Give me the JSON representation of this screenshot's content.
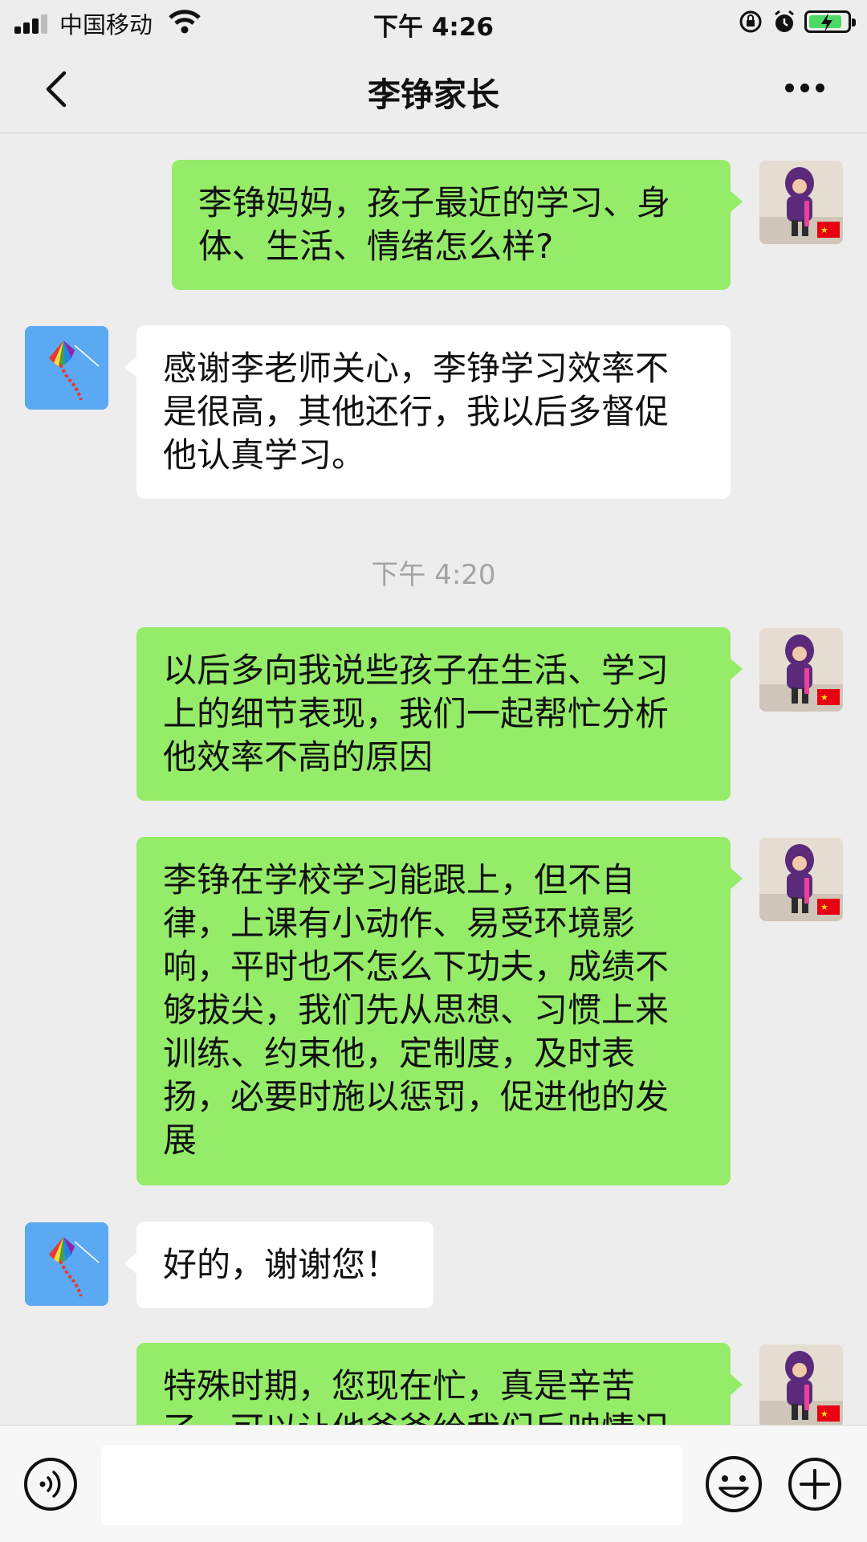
{
  "status_bar": {
    "carrier": "中国移动",
    "time": "下午 4:26"
  },
  "header": {
    "title": "李铮家长"
  },
  "messages": [
    {
      "sender": "me",
      "text": "李铮妈妈，孩子最近的学习、身\n体、生活、情绪怎么样?"
    },
    {
      "sender": "contact",
      "text": "感谢李老师关心，李铮学习效率不\n是很高，其他还行，我以后多督促\n他认真学习。"
    },
    {
      "sender": "me",
      "text": "以后多向我说些孩子在生活、学习\n上的细节表现，我们一起帮忙分析\n他效率不高的原因"
    },
    {
      "sender": "me",
      "text": "李铮在学校学习能跟上，但不自\n律，上课有小动作、易受环境影\n响，平时也不怎么下功夫，成绩不\n够拔尖，我们先从思想、习惯上来\n训练、约束他，定制度，及时表\n扬，必要时施以惩罚，促进他的发\n展"
    },
    {
      "sender": "contact",
      "text": "好的，谢谢您！"
    },
    {
      "sender": "me",
      "text": "特殊时期，您现在忙，真是辛苦\n了，可以让他爸爸给我们反映情况"
    }
  ],
  "timestamp": "下午 4:20",
  "input": {
    "value": ""
  },
  "colors": {
    "my_bubble": "#95ec69",
    "their_bubble": "#ffffff",
    "background": "#ededed"
  },
  "icons": [
    "back-arrow-icon",
    "more-icon",
    "voice-icon",
    "emoji-icon",
    "plus-icon"
  ]
}
